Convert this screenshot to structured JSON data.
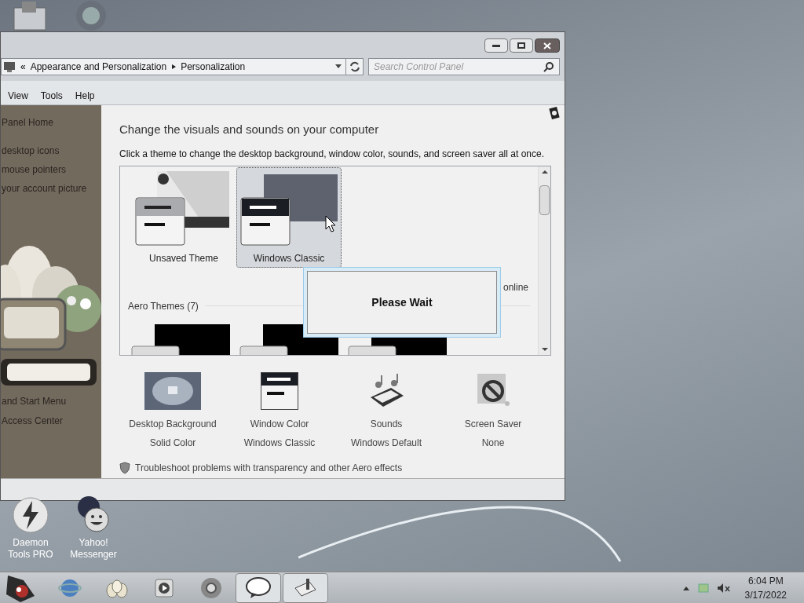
{
  "window": {
    "address": {
      "overflow_marker": "«",
      "crumbs": [
        "Appearance and Personalization",
        "Personalization"
      ]
    },
    "search": {
      "placeholder": "Search Control Panel"
    },
    "menu": [
      "View",
      "Tools",
      "Help"
    ],
    "sidebar": {
      "links_top": [
        "Panel Home",
        "desktop icons",
        "mouse pointers",
        "your account picture"
      ],
      "links_bottom": [
        "and Start Menu",
        "Access Center"
      ]
    },
    "content": {
      "title": "Change the visuals and sounds on your computer",
      "subtitle": "Click a theme to change the desktop background, window color, sounds, and screen saver all at once.",
      "my_themes": [
        {
          "name": "Unsaved Theme",
          "kind": "custom",
          "selected": false
        },
        {
          "name": "Windows Classic",
          "kind": "classic",
          "selected": true
        }
      ],
      "get_more_link": "online",
      "aero_group": "Aero Themes (7)",
      "aero_themes": [
        {
          "kind": "dark"
        },
        {
          "kind": "dark"
        },
        {
          "kind": "dark"
        }
      ],
      "settings": [
        {
          "label": "Desktop Background",
          "value": "Solid Color",
          "kind": "background"
        },
        {
          "label": "Window Color",
          "value": "Windows Classic",
          "kind": "color"
        },
        {
          "label": "Sounds",
          "value": "Windows Default",
          "kind": "sounds"
        },
        {
          "label": "Screen Saver",
          "value": "None",
          "kind": "saver"
        }
      ],
      "troubleshoot_link": "Troubleshoot problems with transparency and other Aero effects"
    }
  },
  "dialog": {
    "message": "Please Wait"
  },
  "desktop_icons": [
    {
      "label": "Daemon Tools PRO",
      "kind": "daemon"
    },
    {
      "label": "Yahoo! Messenger",
      "kind": "yahoo"
    }
  ],
  "taskbar": {
    "items": [
      {
        "kind": "ie",
        "active": false
      },
      {
        "kind": "eggs",
        "active": false
      },
      {
        "kind": "media",
        "active": false
      },
      {
        "kind": "chrome",
        "active": false
      },
      {
        "kind": "talk",
        "active": true
      },
      {
        "kind": "personalize",
        "active": true
      }
    ],
    "clock": {
      "time": "6:04 PM",
      "date": "3/17/2022"
    }
  }
}
